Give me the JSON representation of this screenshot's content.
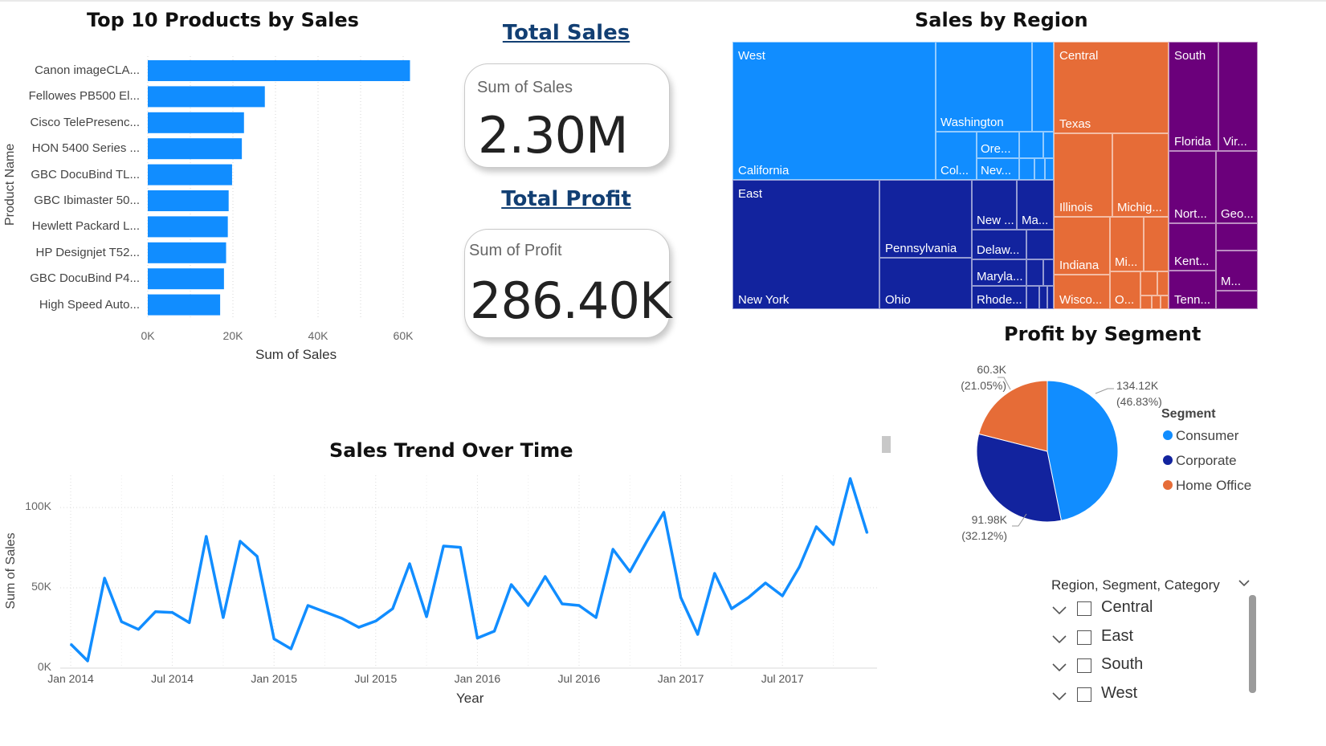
{
  "top_products": {
    "title": "Top 10 Products by Sales",
    "y_axis_title": "Product Name",
    "x_axis_title": "Sum of Sales",
    "x_ticks": [
      "0K",
      "20K",
      "40K",
      "60K"
    ],
    "bar_color": "#118DFF"
  },
  "total_sales": {
    "heading": "Total Sales",
    "label": "Sum of Sales",
    "value": "2.30M"
  },
  "total_profit": {
    "heading": "Total Profit",
    "label": "Sum of Profit",
    "value": "286.40K"
  },
  "sales_by_region": {
    "title": "Sales by Region",
    "regions": [
      {
        "name": "West",
        "color": "#118DFF",
        "states": [
          "California",
          "Washington",
          "Ore...",
          "Col...",
          "Nev..."
        ]
      },
      {
        "name": "East",
        "color": "#12239E",
        "states": [
          "New York",
          "Pennsylvania",
          "Ohio",
          "New ...",
          "Ma...",
          "Delaw...",
          "Maryla...",
          "Rhode..."
        ]
      },
      {
        "name": "Central",
        "color": "#E66C37",
        "states": [
          "Texas",
          "Illinois",
          "Michig...",
          "Indiana",
          "Mi...",
          "Wisco...",
          "O..."
        ]
      },
      {
        "name": "South",
        "color": "#6B007B",
        "states": [
          "Florida",
          "Vir...",
          "Nort...",
          "Geo...",
          "Kent...",
          "M...",
          "Tenn..."
        ]
      }
    ]
  },
  "profit_by_segment": {
    "title": "Profit by Segment",
    "legend_title": "Segment",
    "segments": [
      {
        "name": "Consumer",
        "value_label": "134.12K",
        "pct_label": "(46.83%)",
        "color": "#118DFF"
      },
      {
        "name": "Corporate",
        "value_label": "91.98K",
        "pct_label": "(32.12%)",
        "color": "#12239E"
      },
      {
        "name": "Home Office",
        "value_label": "60.3K",
        "pct_label": "(21.05%)",
        "color": "#E66C37"
      }
    ]
  },
  "sales_trend": {
    "title": "Sales Trend Over Time",
    "y_axis_title": "Sum of Sales",
    "x_axis_title": "Year",
    "y_ticks": [
      "0K",
      "50K",
      "100K"
    ],
    "x_ticks": [
      "Jan 2014",
      "Jul 2014",
      "Jan 2015",
      "Jul 2015",
      "Jan 2016",
      "Jul 2016",
      "Jan 2017",
      "Jul 2017"
    ],
    "line_color": "#118DFF"
  },
  "slicer": {
    "title": "Region, Segment, Category",
    "items": [
      "Central",
      "East",
      "South",
      "West"
    ]
  },
  "chart_data": [
    {
      "type": "bar",
      "title": "Top 10 Products by Sales",
      "xlabel": "Sum of Sales",
      "ylabel": "Product Name",
      "categories": [
        "Canon imageCLA...",
        "Fellowes PB500 El...",
        "Cisco TelePresenc...",
        "HON 5400 Series ...",
        "GBC DocuBind TL...",
        "GBC Ibimaster 50...",
        "Hewlett Packard L...",
        "HP Designjet T52...",
        "GBC DocuBind P4...",
        "High Speed Auto..."
      ],
      "values": [
        61600,
        27500,
        22600,
        22100,
        19800,
        19000,
        18800,
        18400,
        17900,
        17000
      ],
      "xlim": [
        0,
        65000
      ],
      "grid": true
    },
    {
      "type": "line",
      "title": "Sales Trend Over Time",
      "xlabel": "Year",
      "ylabel": "Sum of Sales",
      "x": [
        "2014-01",
        "2014-02",
        "2014-03",
        "2014-04",
        "2014-05",
        "2014-06",
        "2014-07",
        "2014-08",
        "2014-09",
        "2014-10",
        "2014-11",
        "2014-12",
        "2015-01",
        "2015-02",
        "2015-03",
        "2015-04",
        "2015-05",
        "2015-06",
        "2015-07",
        "2015-08",
        "2015-09",
        "2015-10",
        "2015-11",
        "2015-12",
        "2016-01",
        "2016-02",
        "2016-03",
        "2016-04",
        "2016-05",
        "2016-06",
        "2016-07",
        "2016-08",
        "2016-09",
        "2016-10",
        "2016-11",
        "2016-12",
        "2017-01",
        "2017-02",
        "2017-03",
        "2017-04",
        "2017-05",
        "2017-06",
        "2017-07",
        "2017-08",
        "2017-09",
        "2017-10",
        "2017-11",
        "2017-12"
      ],
      "values": [
        15000,
        4500,
        56000,
        28900,
        24100,
        35100,
        34600,
        28300,
        82000,
        31500,
        79000,
        69600,
        18200,
        12000,
        39000,
        35000,
        31000,
        25400,
        29300,
        37000,
        65000,
        32000,
        76000,
        75200,
        18700,
        23000,
        52000,
        39000,
        57000,
        40000,
        39000,
        31500,
        74000,
        60000,
        79000,
        97000,
        44000,
        21000,
        59000,
        37000,
        44000,
        53000,
        45000,
        63000,
        88000,
        77000,
        118000,
        84000
      ],
      "ylim": [
        0,
        125000
      ],
      "grid": true
    },
    {
      "type": "pie",
      "title": "Profit by Segment",
      "categories": [
        "Consumer",
        "Corporate",
        "Home Office"
      ],
      "values": [
        134120,
        91980,
        60300
      ],
      "percentages": [
        46.83,
        32.12,
        21.05
      ],
      "legend": "right"
    },
    {
      "type": "treemap",
      "title": "Sales by Region",
      "categories": [
        "West",
        "East",
        "Central",
        "South"
      ]
    }
  ]
}
